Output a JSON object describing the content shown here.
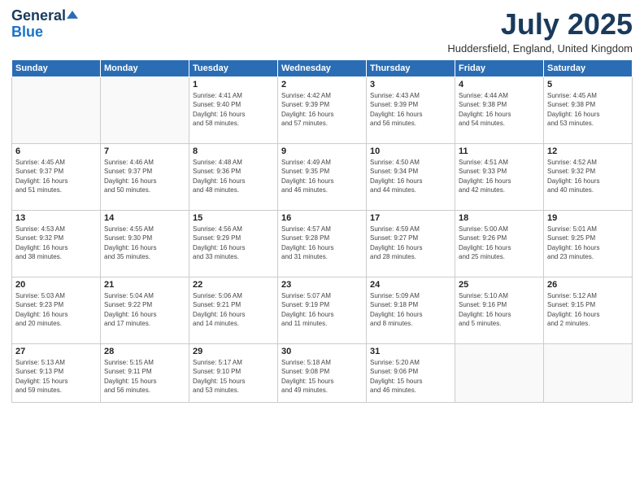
{
  "header": {
    "logo_line1": "General",
    "logo_line2": "Blue",
    "month": "July 2025",
    "location": "Huddersfield, England, United Kingdom"
  },
  "weekdays": [
    "Sunday",
    "Monday",
    "Tuesday",
    "Wednesday",
    "Thursday",
    "Friday",
    "Saturday"
  ],
  "weeks": [
    [
      {
        "day": "",
        "info": ""
      },
      {
        "day": "",
        "info": ""
      },
      {
        "day": "1",
        "info": "Sunrise: 4:41 AM\nSunset: 9:40 PM\nDaylight: 16 hours\nand 58 minutes."
      },
      {
        "day": "2",
        "info": "Sunrise: 4:42 AM\nSunset: 9:39 PM\nDaylight: 16 hours\nand 57 minutes."
      },
      {
        "day": "3",
        "info": "Sunrise: 4:43 AM\nSunset: 9:39 PM\nDaylight: 16 hours\nand 56 minutes."
      },
      {
        "day": "4",
        "info": "Sunrise: 4:44 AM\nSunset: 9:38 PM\nDaylight: 16 hours\nand 54 minutes."
      },
      {
        "day": "5",
        "info": "Sunrise: 4:45 AM\nSunset: 9:38 PM\nDaylight: 16 hours\nand 53 minutes."
      }
    ],
    [
      {
        "day": "6",
        "info": "Sunrise: 4:45 AM\nSunset: 9:37 PM\nDaylight: 16 hours\nand 51 minutes."
      },
      {
        "day": "7",
        "info": "Sunrise: 4:46 AM\nSunset: 9:37 PM\nDaylight: 16 hours\nand 50 minutes."
      },
      {
        "day": "8",
        "info": "Sunrise: 4:48 AM\nSunset: 9:36 PM\nDaylight: 16 hours\nand 48 minutes."
      },
      {
        "day": "9",
        "info": "Sunrise: 4:49 AM\nSunset: 9:35 PM\nDaylight: 16 hours\nand 46 minutes."
      },
      {
        "day": "10",
        "info": "Sunrise: 4:50 AM\nSunset: 9:34 PM\nDaylight: 16 hours\nand 44 minutes."
      },
      {
        "day": "11",
        "info": "Sunrise: 4:51 AM\nSunset: 9:33 PM\nDaylight: 16 hours\nand 42 minutes."
      },
      {
        "day": "12",
        "info": "Sunrise: 4:52 AM\nSunset: 9:32 PM\nDaylight: 16 hours\nand 40 minutes."
      }
    ],
    [
      {
        "day": "13",
        "info": "Sunrise: 4:53 AM\nSunset: 9:32 PM\nDaylight: 16 hours\nand 38 minutes."
      },
      {
        "day": "14",
        "info": "Sunrise: 4:55 AM\nSunset: 9:30 PM\nDaylight: 16 hours\nand 35 minutes."
      },
      {
        "day": "15",
        "info": "Sunrise: 4:56 AM\nSunset: 9:29 PM\nDaylight: 16 hours\nand 33 minutes."
      },
      {
        "day": "16",
        "info": "Sunrise: 4:57 AM\nSunset: 9:28 PM\nDaylight: 16 hours\nand 31 minutes."
      },
      {
        "day": "17",
        "info": "Sunrise: 4:59 AM\nSunset: 9:27 PM\nDaylight: 16 hours\nand 28 minutes."
      },
      {
        "day": "18",
        "info": "Sunrise: 5:00 AM\nSunset: 9:26 PM\nDaylight: 16 hours\nand 25 minutes."
      },
      {
        "day": "19",
        "info": "Sunrise: 5:01 AM\nSunset: 9:25 PM\nDaylight: 16 hours\nand 23 minutes."
      }
    ],
    [
      {
        "day": "20",
        "info": "Sunrise: 5:03 AM\nSunset: 9:23 PM\nDaylight: 16 hours\nand 20 minutes."
      },
      {
        "day": "21",
        "info": "Sunrise: 5:04 AM\nSunset: 9:22 PM\nDaylight: 16 hours\nand 17 minutes."
      },
      {
        "day": "22",
        "info": "Sunrise: 5:06 AM\nSunset: 9:21 PM\nDaylight: 16 hours\nand 14 minutes."
      },
      {
        "day": "23",
        "info": "Sunrise: 5:07 AM\nSunset: 9:19 PM\nDaylight: 16 hours\nand 11 minutes."
      },
      {
        "day": "24",
        "info": "Sunrise: 5:09 AM\nSunset: 9:18 PM\nDaylight: 16 hours\nand 8 minutes."
      },
      {
        "day": "25",
        "info": "Sunrise: 5:10 AM\nSunset: 9:16 PM\nDaylight: 16 hours\nand 5 minutes."
      },
      {
        "day": "26",
        "info": "Sunrise: 5:12 AM\nSunset: 9:15 PM\nDaylight: 16 hours\nand 2 minutes."
      }
    ],
    [
      {
        "day": "27",
        "info": "Sunrise: 5:13 AM\nSunset: 9:13 PM\nDaylight: 15 hours\nand 59 minutes."
      },
      {
        "day": "28",
        "info": "Sunrise: 5:15 AM\nSunset: 9:11 PM\nDaylight: 15 hours\nand 56 minutes."
      },
      {
        "day": "29",
        "info": "Sunrise: 5:17 AM\nSunset: 9:10 PM\nDaylight: 15 hours\nand 53 minutes."
      },
      {
        "day": "30",
        "info": "Sunrise: 5:18 AM\nSunset: 9:08 PM\nDaylight: 15 hours\nand 49 minutes."
      },
      {
        "day": "31",
        "info": "Sunrise: 5:20 AM\nSunset: 9:06 PM\nDaylight: 15 hours\nand 46 minutes."
      },
      {
        "day": "",
        "info": ""
      },
      {
        "day": "",
        "info": ""
      }
    ]
  ]
}
